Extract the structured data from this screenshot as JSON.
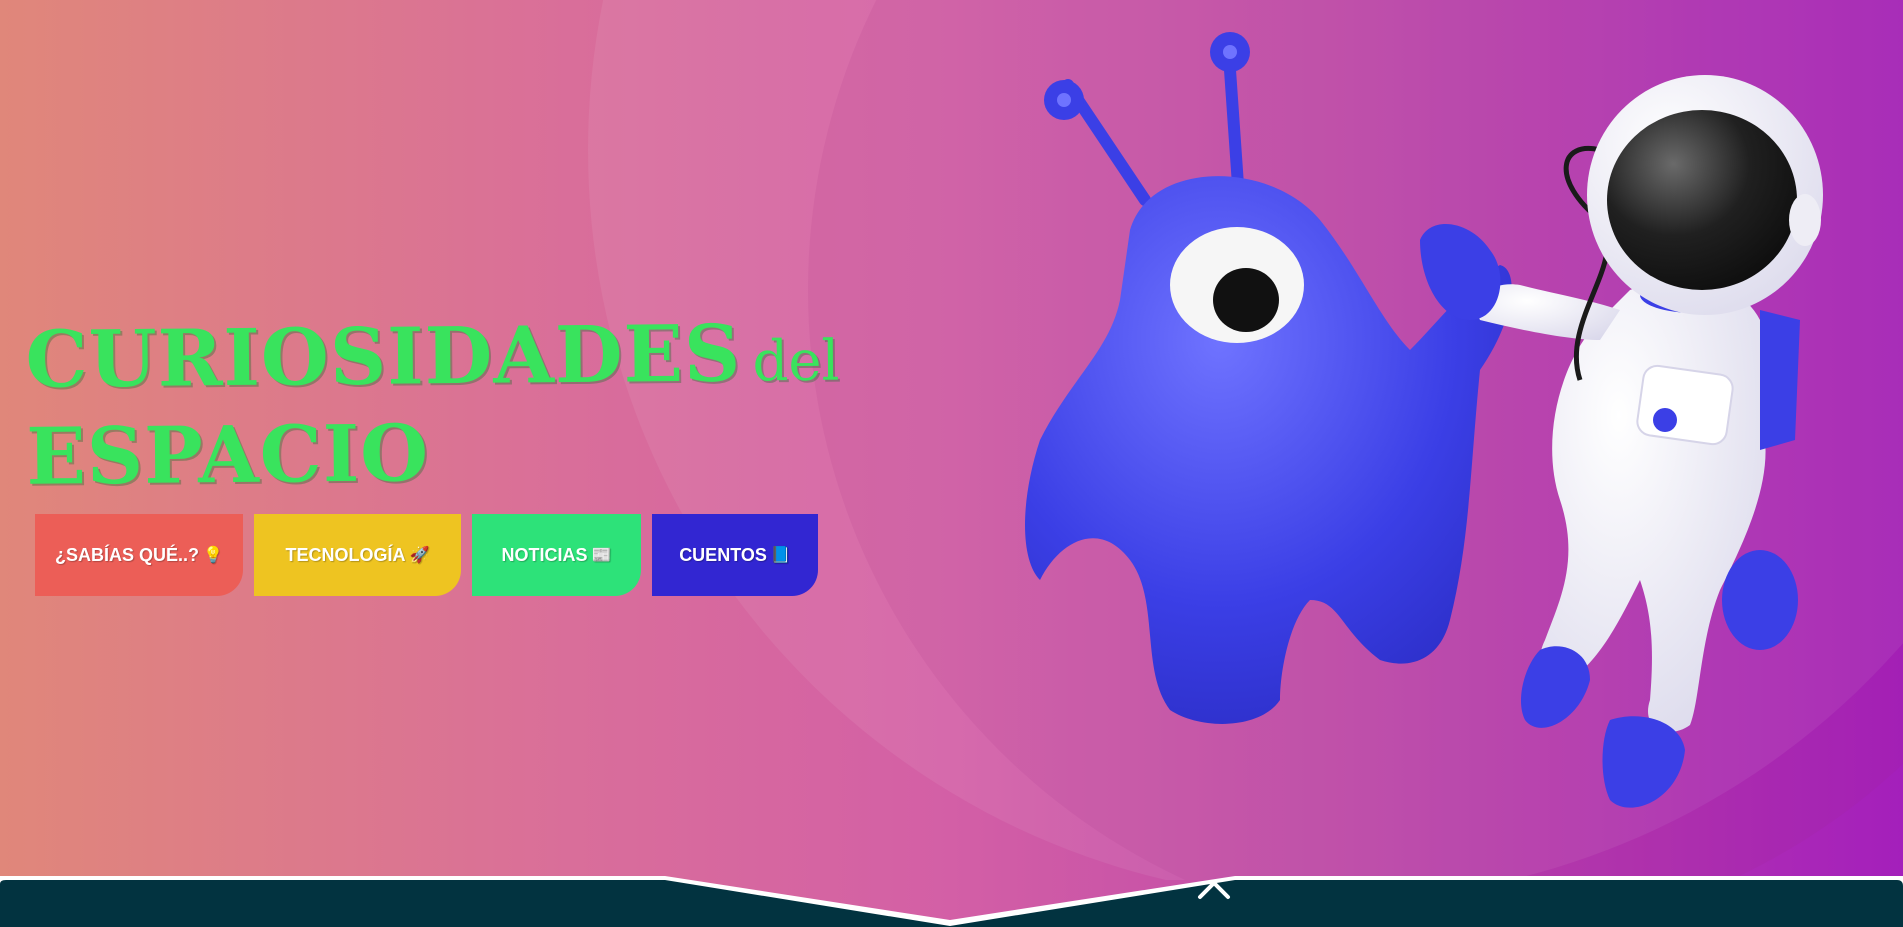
{
  "hero": {
    "title_main": "CURIOSIDADES",
    "title_del": "del",
    "title_line2": "ESPACIO",
    "title_color": "#39e35d"
  },
  "categories": [
    {
      "label": "¿SABÍAS QUÉ..?",
      "icon": "lightbulb-icon",
      "glyph": "💡",
      "color": "#ec5e57"
    },
    {
      "label": "TECNOLOGÍA",
      "icon": "rocket-icon",
      "glyph": "🚀",
      "color": "#eec421"
    },
    {
      "label": "NOTICIAS",
      "icon": "newspaper-icon",
      "glyph": "📰",
      "color": "#2de279"
    },
    {
      "label": "CUENTOS",
      "icon": "book-icon",
      "glyph": "📘",
      "color": "#3226d2"
    }
  ],
  "illustration": {
    "alien_color": "#3b3fe6",
    "astronaut_color": "#f2f1f8"
  },
  "footer": {
    "bar_color": "#023340",
    "scroll_icon": "chevron-up-icon"
  }
}
